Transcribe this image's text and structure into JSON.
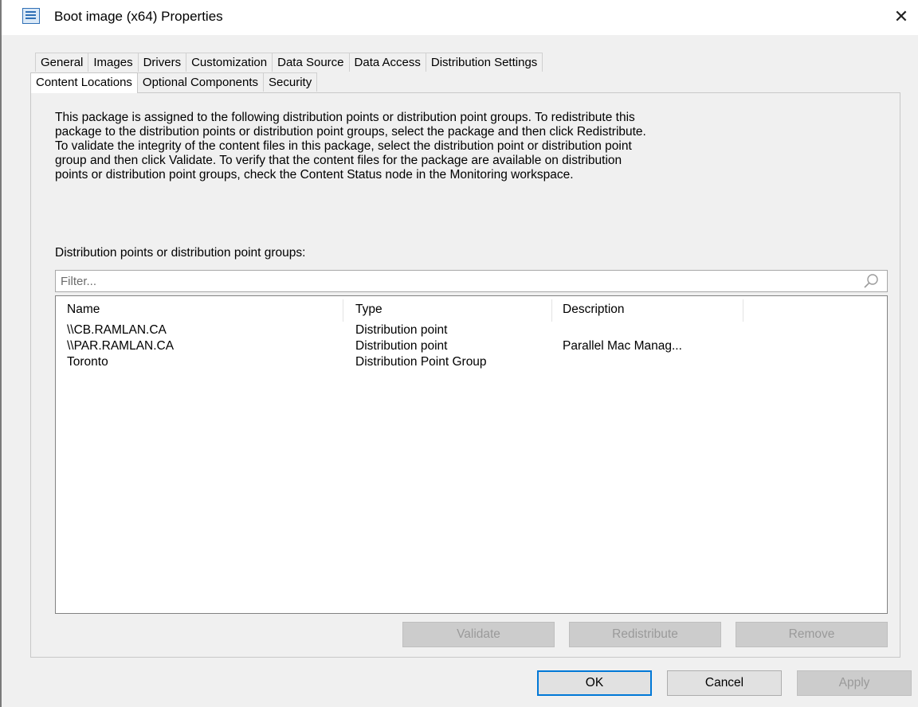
{
  "window": {
    "title": "Boot image (x64) Properties",
    "close_symbol": "✕"
  },
  "tabs": {
    "row1": [
      "General",
      "Images",
      "Drivers",
      "Customization",
      "Data Source",
      "Data Access",
      "Distribution Settings"
    ],
    "row2": [
      "Content Locations",
      "Optional Components",
      "Security"
    ],
    "active": "Content Locations"
  },
  "content": {
    "description_lines": [
      "This package is assigned to the following distribution points or distribution point groups. To redistribute this",
      "package to the distribution points or distribution point groups, select the package and then click Redistribute.",
      "To validate the integrity of the content files in this package, select the distribution point or distribution point",
      "group and then click Validate. To verify that the content files for the package are available on distribution",
      "points or distribution point groups, check the Content Status node in the Monitoring workspace."
    ],
    "list_label": "Distribution points or distribution point groups:",
    "filter_placeholder": "Filter...",
    "columns": [
      "Name",
      "Type",
      "Description"
    ],
    "rows": [
      {
        "name": "\\\\CB.RAMLAN.CA",
        "type": "Distribution point",
        "description": ""
      },
      {
        "name": "\\\\PAR.RAMLAN.CA",
        "type": "Distribution point",
        "description": "Parallel Mac Manag..."
      },
      {
        "name": "Toronto",
        "type": "Distribution Point Group",
        "description": ""
      }
    ],
    "buttons": {
      "validate": "Validate",
      "redistribute": "Redistribute",
      "remove": "Remove"
    }
  },
  "footer": {
    "ok": "OK",
    "cancel": "Cancel",
    "apply": "Apply"
  },
  "colors": {
    "accent": "#0078d7",
    "panel_bg": "#f0f0f0",
    "disabled_bg": "#cccccc"
  }
}
